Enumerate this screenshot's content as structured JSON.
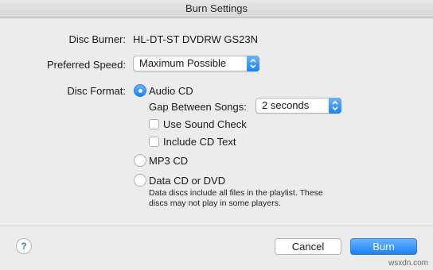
{
  "window": {
    "title": "Burn Settings"
  },
  "disc_burner": {
    "label": "Disc Burner:",
    "value": "HL-DT-ST DVDRW  GS23N"
  },
  "preferred_speed": {
    "label": "Preferred Speed:",
    "value": "Maximum Possible"
  },
  "disc_format": {
    "label": "Disc Format:",
    "options": [
      {
        "label": "Audio CD",
        "selected": true
      },
      {
        "label": "MP3 CD",
        "selected": false
      },
      {
        "label": "Data CD or DVD",
        "selected": false
      }
    ],
    "audio_cd": {
      "gap_label": "Gap Between Songs:",
      "gap_value": "2 seconds",
      "sound_check_label": "Use Sound Check",
      "sound_check_checked": false,
      "cd_text_label": "Include CD Text",
      "cd_text_checked": false
    },
    "data_note_line1": "Data discs include all files in the playlist. These",
    "data_note_line2": "discs may not play in some players."
  },
  "footer": {
    "help_label": "?",
    "cancel_label": "Cancel",
    "burn_label": "Burn"
  },
  "watermark": "wsxdn.com",
  "colors": {
    "accent": "#1a82fb",
    "background": "#ececec"
  }
}
